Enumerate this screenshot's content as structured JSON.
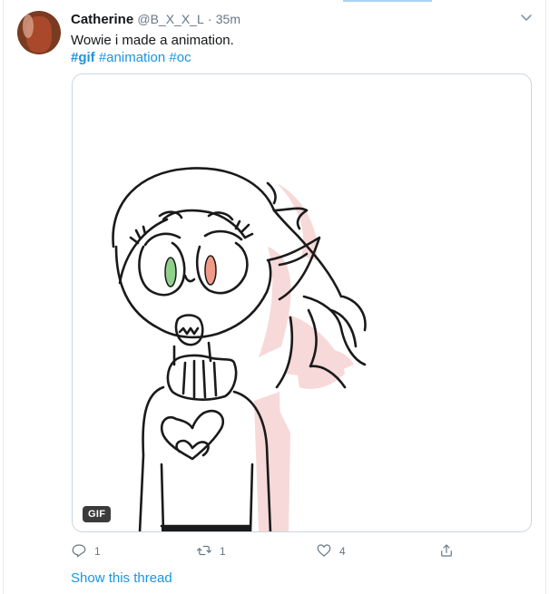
{
  "tweet": {
    "author_name": "Catherine",
    "handle": "@B_X_X_L",
    "separator": "·",
    "time": "35m",
    "text": "Wowie i made a animation.",
    "hashtags": [
      "#gif",
      "#animation",
      "#oc"
    ],
    "media_badge": "GIF",
    "reply_count": "1",
    "retweet_count": "1",
    "like_count": "4",
    "show_thread_label": "Show this thread"
  },
  "icons": {
    "caret": "chevron-down-icon",
    "reply": "reply-icon",
    "retweet": "retweet-icon",
    "like": "heart-icon",
    "share": "share-icon"
  },
  "colors": {
    "link": "#1b95e0",
    "secondary_text": "#657786",
    "border": "#ccd6dd"
  }
}
